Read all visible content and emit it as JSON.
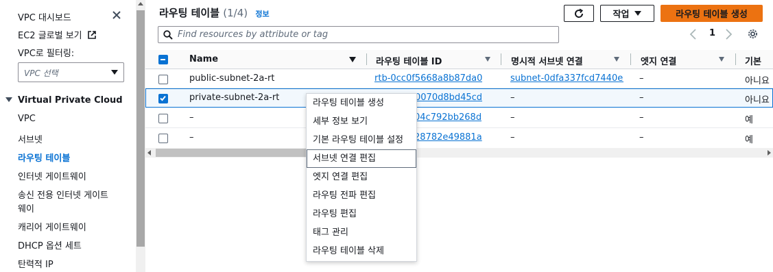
{
  "sidebar": {
    "items_top": [
      {
        "label": "VPC 대시보드"
      },
      {
        "label": "EC2 글로벌 보기"
      }
    ],
    "filter_label": "VPC로 필터링:",
    "filter_placeholder": "VPC 선택",
    "section_title": "Virtual Private Cloud",
    "nav": [
      {
        "label": "VPC"
      },
      {
        "label": "서브넷"
      },
      {
        "label": "라우팅 테이블"
      },
      {
        "label": "인터넷 게이트웨이"
      },
      {
        "label": "송신 전용 인터넷 게이트"
      },
      {
        "label": "웨이"
      },
      {
        "label": "캐리어 게이트웨이"
      },
      {
        "label": "DHCP 옵션 세트"
      },
      {
        "label": "탄력적 IP"
      }
    ],
    "active_item": "라우팅 테이블"
  },
  "header": {
    "title": "라우팅 테이블",
    "count": "(1/4)",
    "info_link": "정보",
    "actions_label": "작업",
    "create_label": "라우팅 테이블 생성"
  },
  "search": {
    "placeholder": "Find resources by attribute or tag"
  },
  "pagination": {
    "current_page": "1"
  },
  "table": {
    "columns": [
      "Name",
      "라우팅 테이블 ID",
      "명시적 서브넷 연결",
      "엣지 연결",
      "기본"
    ],
    "rows": [
      {
        "name": "public-subnet-2a-rt",
        "rt_id": "rtb-0cc0f5668a8b87da0",
        "subnet": "subnet-0dfa337fcd7440e...",
        "edge": "–",
        "main": "아니요",
        "selected": false
      },
      {
        "name": "private-subnet-2a-rt",
        "rt_id": "0070d8bd45cd",
        "subnet": "–",
        "edge": "–",
        "main": "아니요",
        "selected": true
      },
      {
        "name": "–",
        "rt_id": "04c792bb268d",
        "subnet": "–",
        "edge": "–",
        "main": "예",
        "selected": false
      },
      {
        "name": "–",
        "rt_id": "28782e49881a",
        "subnet": "–",
        "edge": "–",
        "main": "예",
        "selected": false
      }
    ]
  },
  "context_menu": {
    "items": [
      "라우팅 테이블 생성",
      "세부 정보 보기",
      "기본 라우팅 테이블 설정",
      "서브넷 연결 편집",
      "엣지 연결 편집",
      "라우팅 전파 편집",
      "라우팅 편집",
      "태그 관리",
      "라우팅 테이블 삭제"
    ],
    "hovered_item": "서브넷 연결 편집"
  },
  "colors": {
    "accent": "#0972d3",
    "primary_button": "#ec7211",
    "text": "#16191f"
  }
}
